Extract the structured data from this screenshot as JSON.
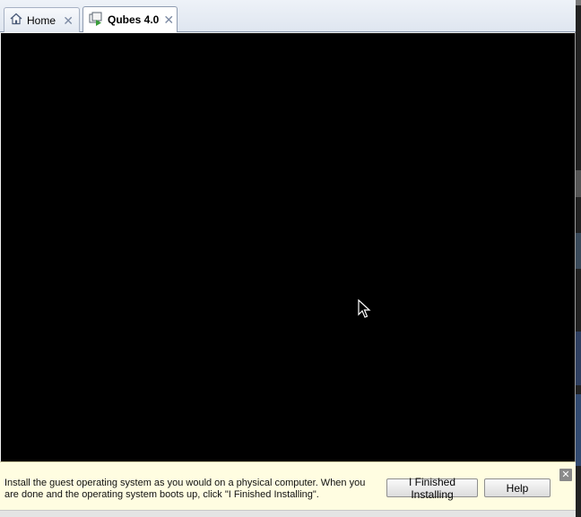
{
  "tabs": [
    {
      "label": "Home",
      "icon": "home-icon",
      "active": false
    },
    {
      "label": "Qubes 4.0",
      "icon": "vm-icon",
      "active": true
    }
  ],
  "tab_close_glyph": "✕",
  "infobar": {
    "message": "Install the guest operating system as you would on a physical computer. When you are done and the operating system boots up, click \"I Finished Installing\".",
    "finished_label": "I Finished Installing",
    "help_label": "Help",
    "close_glyph": "✕"
  },
  "colors": {
    "screen": "#000000",
    "infobar_bg": "#fffde1",
    "tab_border": "#8e9bb0"
  }
}
